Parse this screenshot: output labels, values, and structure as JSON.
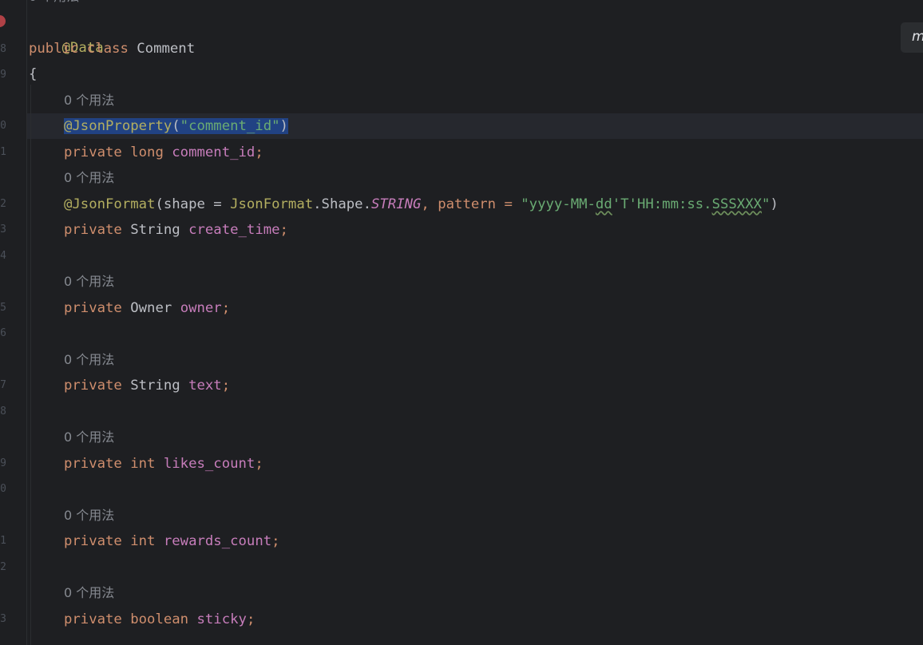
{
  "hints": {
    "usages": "0 个用法"
  },
  "gutter": {
    "line_numbers": [
      "8",
      "9",
      "0",
      "1",
      "2",
      "3",
      "4",
      "5",
      "6",
      "7",
      "8",
      "9",
      "0",
      "1",
      "2",
      "3"
    ]
  },
  "code": {
    "ann_data": "@Data",
    "kw_public": "public",
    "kw_class": "class",
    "class_name": "Comment",
    "open_brace": "{",
    "ann_json_property": "@JsonProperty",
    "paren_open": "(",
    "paren_close": ")",
    "str_comment_id": "\"comment_id\"",
    "kw_private": "private",
    "kw_long": "long",
    "field_comment_id": "comment_id",
    "semicolon": ";",
    "ann_json_format": "@JsonFormat",
    "shape_eq": "shape = ",
    "json_format_cls": "JsonFormat",
    "shape_member": ".Shape.",
    "enum_string": "STRING",
    "pattern_eq": ", pattern = ",
    "str_pattern_1": "\"yyyy-MM-",
    "str_pattern_dd": "dd",
    "str_pattern_2": "'T'HH:mm:ss.",
    "str_pattern_sssxxx": "SSSXXX",
    "str_pattern_3": "\"",
    "type_string": "String",
    "field_create_time": "create_time",
    "type_owner": "Owner",
    "field_owner": "owner",
    "field_text": "text",
    "kw_int": "int",
    "field_likes_count": "likes_count",
    "field_rewards_count": "rewards_count",
    "kw_boolean": "boolean",
    "field_sticky": "sticky"
  },
  "widget": {
    "label": "m"
  },
  "colors": {
    "background": "#1e1f22",
    "keyword": "#cf8e6d",
    "annotation": "#b3ae60",
    "field": "#c77dbb",
    "string": "#6aab73",
    "selection": "#214283",
    "breakpoint": "#c0454a"
  }
}
